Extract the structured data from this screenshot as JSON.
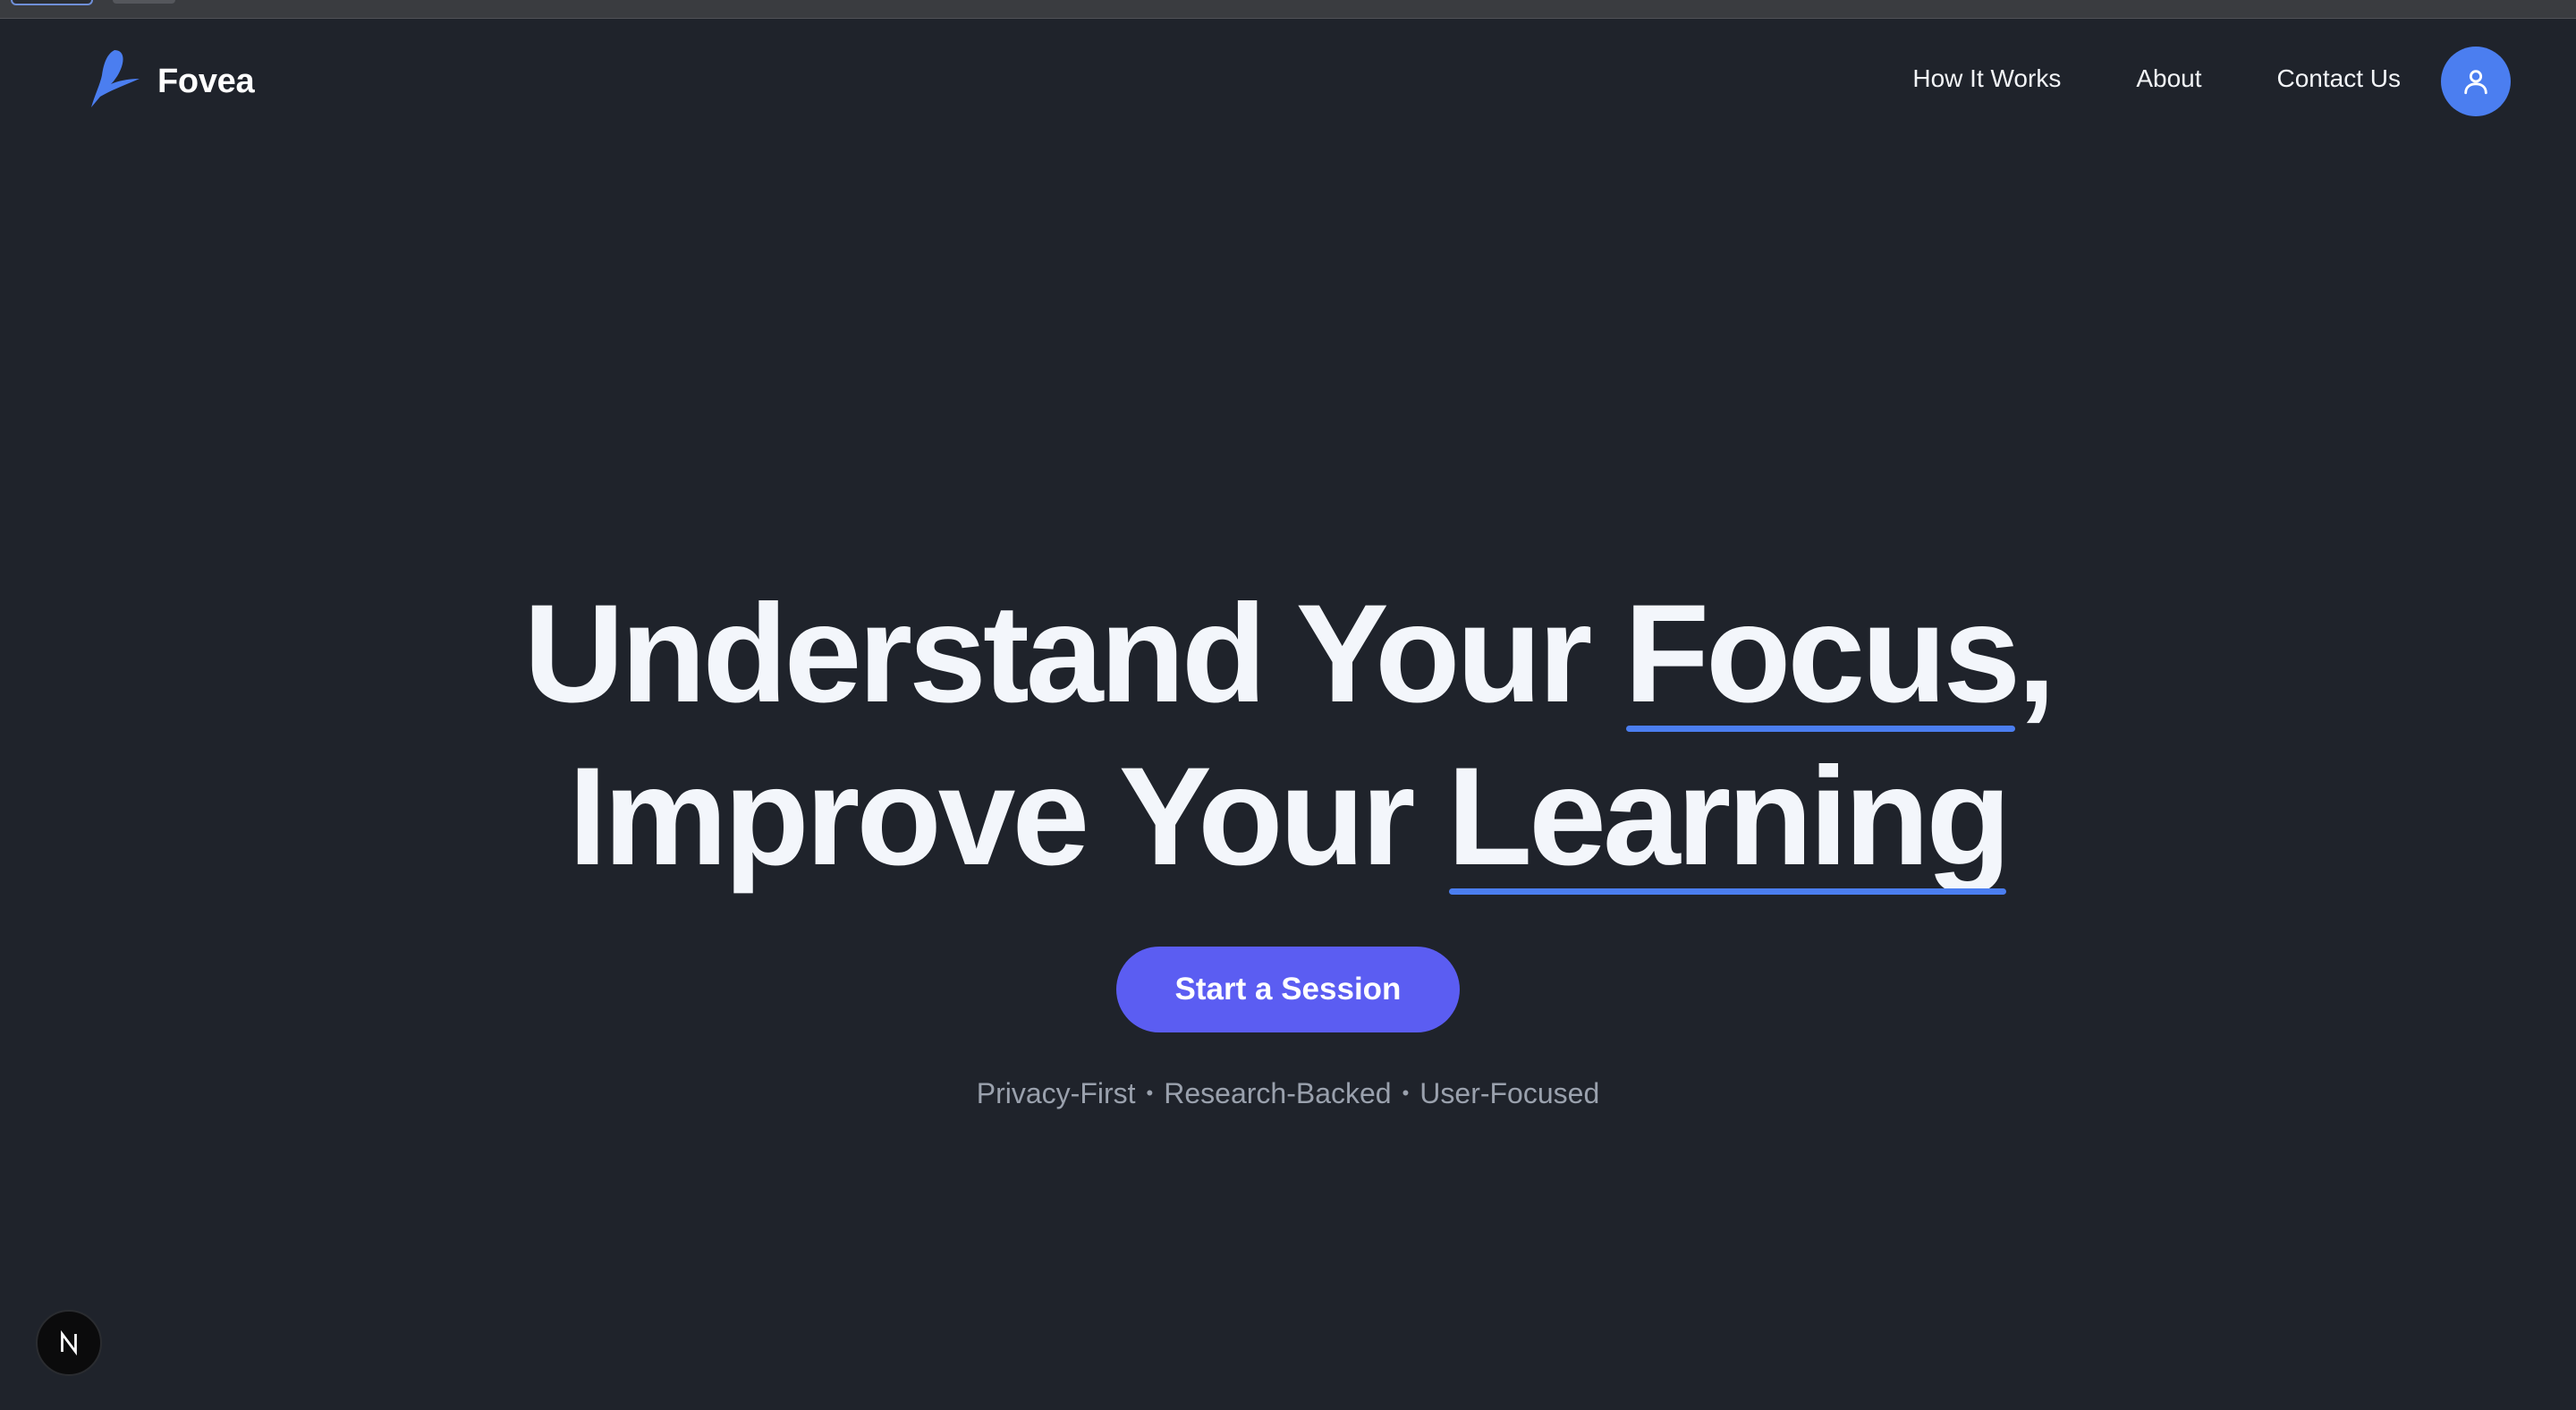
{
  "brand": {
    "name": "Fovea",
    "logo_icon": "feather-logo-icon",
    "accent_color": "#4b7ef0"
  },
  "nav": {
    "items": [
      {
        "label": "How It Works"
      },
      {
        "label": "About"
      },
      {
        "label": "Contact Us"
      }
    ],
    "profile_icon": "user-icon"
  },
  "hero": {
    "line1_prefix": "Understand Your ",
    "line1_highlight": "Focus",
    "line1_suffix": ",",
    "line2_prefix": "Improve Your ",
    "line2_highlight": "Learning",
    "cta_label": "Start a Session",
    "cta_color": "#5b5df2",
    "tagline": [
      "Privacy-First",
      "Research-Backed",
      "User-Focused"
    ],
    "tagline_separator": "•"
  },
  "dev_badge": {
    "icon": "nextjs-icon",
    "letter": "N"
  },
  "colors": {
    "background": "#1f232b",
    "headline": "#f3f6fb",
    "tagline": "#9aa1ad"
  }
}
